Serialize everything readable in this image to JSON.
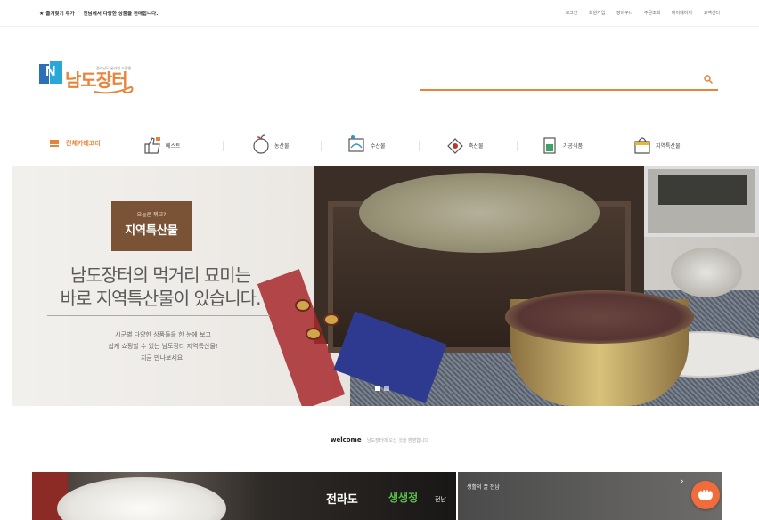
{
  "topbar": {
    "favorite": "즐겨찾기 추가",
    "welcome_msg": "전남에서 다양한 상품을 판매합니다.",
    "links": [
      "로그인",
      "회원가입",
      "장바구니",
      "주문조회",
      "마이페이지",
      "고객센터"
    ]
  },
  "logo": {
    "name": "남도장터",
    "tagline": "전라남도 온라인 쇼핑몰"
  },
  "search": {
    "placeholder": ""
  },
  "gnb": {
    "all_categories": "전체카테고리",
    "items": [
      "베스트",
      "농산물",
      "수산물",
      "축산물",
      "가공식품",
      "지역특산물"
    ]
  },
  "banner": {
    "tag_small": "오늘은 뭐고?",
    "tag_big": "지역특산물",
    "headline_1": "남도장터의 먹거리 묘미는",
    "headline_2": "바로 지역특산물이 있습니다.",
    "desc_1": "시군별 다양한 상품들을 한 눈에 보고",
    "desc_2": "쉽게 쇼핑할 수 있는 남도장터 지역특산물!",
    "desc_3": "지금 만나보세요!"
  },
  "welcome": {
    "title": "welcome",
    "sub": "남도장터에 오신 것을 환영합니다"
  },
  "promos": [
    {
      "t1": "전라도",
      "t2": "생생정",
      "t3": "전남"
    },
    {
      "t": "생활의 꿀 전남"
    }
  ],
  "colors": {
    "accent": "#e8833a",
    "fab": "#f26b3a",
    "tag": "#7a5236"
  }
}
